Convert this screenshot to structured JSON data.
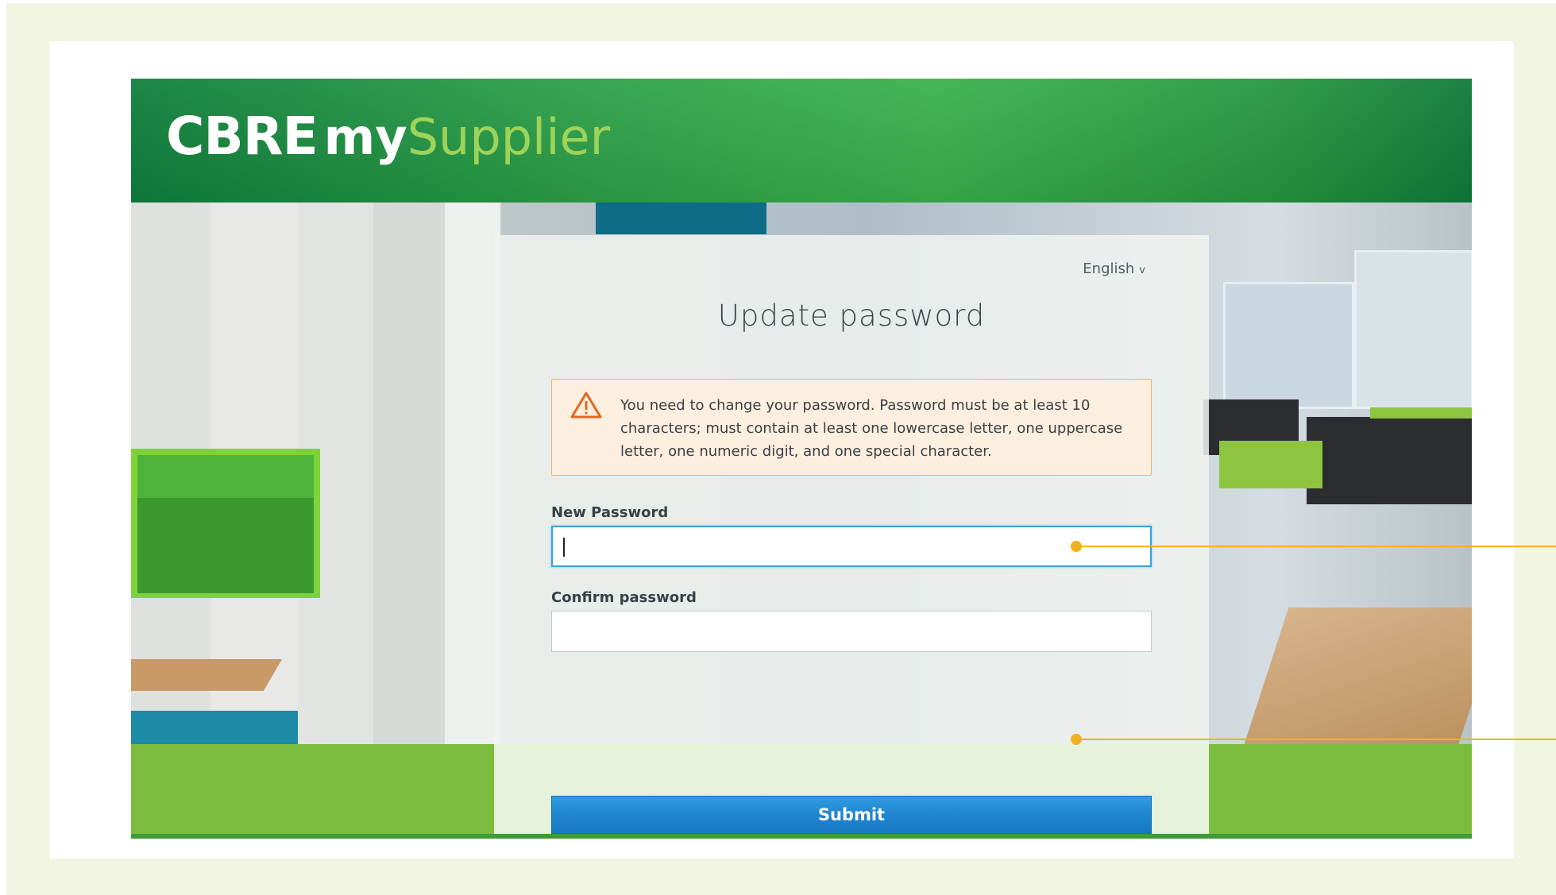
{
  "brand": {
    "logo_primary": "CBRE",
    "logo_my": "my",
    "logo_supplier": "Supplier",
    "header_color": "#2ea148",
    "supplier_color": "#9ed35a"
  },
  "form": {
    "language": "English",
    "language_icon": "chevron-down-icon",
    "title": "Update password",
    "alert": {
      "icon": "warning-icon",
      "text": "You need to change your password. Password must be at least 10 characters; must contain at least one lowercase letter, one uppercase letter, one numeric digit, and one special character."
    },
    "new_password": {
      "label": "New Password",
      "value": ""
    },
    "confirm_password": {
      "label": "Confirm password",
      "value": ""
    },
    "submit_label": "Submit",
    "submit_color": "#1f86cf"
  },
  "annotations": {
    "color": "#f2b21d"
  }
}
